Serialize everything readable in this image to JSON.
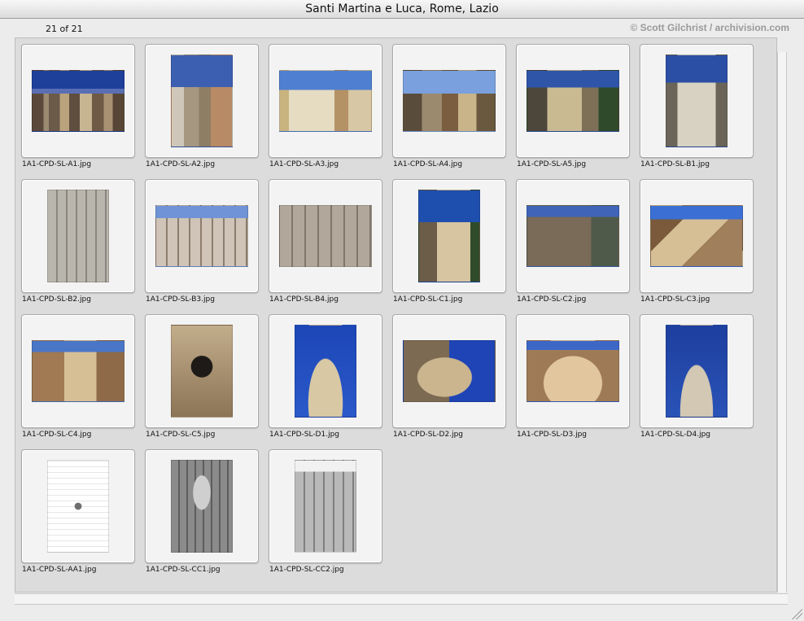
{
  "window": {
    "title": "Santi Martina e Luca, Rome, Lazio"
  },
  "header": {
    "count": "21 of 21",
    "credit": "© Scott Gilchrist / archivision.com"
  },
  "thumbnails": [
    {
      "caption": "1A1-CPD-SL-A1.jpg"
    },
    {
      "caption": "1A1-CPD-SL-A2.jpg"
    },
    {
      "caption": "1A1-CPD-SL-A3.jpg"
    },
    {
      "caption": "1A1-CPD-SL-A4.jpg"
    },
    {
      "caption": "1A1-CPD-SL-A5.jpg"
    },
    {
      "caption": "1A1-CPD-SL-B1.jpg"
    },
    {
      "caption": "1A1-CPD-SL-B2.jpg"
    },
    {
      "caption": "1A1-CPD-SL-B3.jpg"
    },
    {
      "caption": "1A1-CPD-SL-B4.jpg"
    },
    {
      "caption": "1A1-CPD-SL-C1.jpg"
    },
    {
      "caption": "1A1-CPD-SL-C2.jpg"
    },
    {
      "caption": "1A1-CPD-SL-C3.jpg"
    },
    {
      "caption": "1A1-CPD-SL-C4.jpg"
    },
    {
      "caption": "1A1-CPD-SL-C5.jpg"
    },
    {
      "caption": "1A1-CPD-SL-D1.jpg"
    },
    {
      "caption": "1A1-CPD-SL-D2.jpg"
    },
    {
      "caption": "1A1-CPD-SL-D3.jpg"
    },
    {
      "caption": "1A1-CPD-SL-D4.jpg"
    },
    {
      "caption": "1A1-CPD-SL-AA1.jpg"
    },
    {
      "caption": "1A1-CPD-SL-CC1.jpg"
    },
    {
      "caption": "1A1-CPD-SL-CC2.jpg"
    }
  ]
}
